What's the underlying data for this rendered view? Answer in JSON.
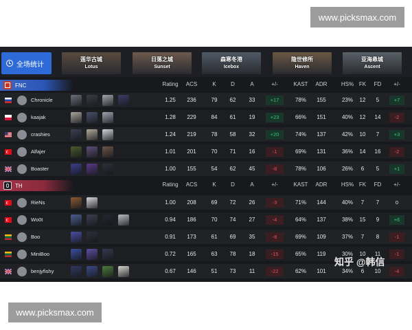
{
  "watermark_top": "www.picksmax.com",
  "watermark_bottom": "www.picksmax.com",
  "zhihu_watermark": "知乎 @韩信",
  "overall_button": "全场统计",
  "maps": [
    {
      "cn": "莲华古城",
      "en": "Lotus",
      "color": "#5a4b3e"
    },
    {
      "cn": "日落之城",
      "en": "Sunset",
      "color": "#6d5a4d"
    },
    {
      "cn": "森寒冬港",
      "en": "Icebox",
      "color": "#4f5a66"
    },
    {
      "cn": "隐世修所",
      "en": "Haven",
      "color": "#6b5845"
    },
    {
      "cn": "亚海悬城",
      "en": "Ascent",
      "color": "#596068"
    }
  ],
  "columns": [
    "Rating",
    "ACS",
    "K",
    "D",
    "A",
    "+/-",
    "KAST",
    "ADR",
    "HS%",
    "FK",
    "FD",
    "+/-"
  ],
  "teams": [
    {
      "name": "FNC",
      "players": [
        {
          "name": "Chronicle",
          "flag": "ru",
          "agents": [
            "#6b6f7a",
            "#3b3d47",
            "#a0a4ad",
            "#3d3b66"
          ],
          "rating": "1.25",
          "acs": "236",
          "k": "79",
          "d": "62",
          "a": "33",
          "diff": "+17",
          "kast": "78%",
          "adr": "155",
          "hs": "23%",
          "fk": "12",
          "fd": "5",
          "fdiff": "+7"
        },
        {
          "name": "kaajak",
          "flag": "pl",
          "agents": [
            "#a8a39a",
            "#4a4f6a",
            "#9fa4b0"
          ],
          "rating": "1.28",
          "acs": "229",
          "k": "84",
          "d": "61",
          "a": "19",
          "diff": "+23",
          "kast": "66%",
          "adr": "151",
          "hs": "40%",
          "fk": "12",
          "fd": "14",
          "fdiff": "-2"
        },
        {
          "name": "crashies",
          "flag": "us",
          "agents": [
            "#3c3f52",
            "#b1a897",
            "#cfd3da"
          ],
          "rating": "1.24",
          "acs": "219",
          "k": "78",
          "d": "58",
          "a": "32",
          "diff": "+20",
          "kast": "74%",
          "adr": "137",
          "hs": "42%",
          "fk": "10",
          "fd": "7",
          "fdiff": "+3"
        },
        {
          "name": "Alfajer",
          "flag": "tr",
          "agents": [
            "#4a5b2d",
            "#5f4e77",
            "#6a5648"
          ],
          "rating": "1.01",
          "acs": "201",
          "k": "70",
          "d": "71",
          "a": "16",
          "diff": "-1",
          "kast": "69%",
          "adr": "131",
          "hs": "36%",
          "fk": "14",
          "fd": "16",
          "fdiff": "-2"
        },
        {
          "name": "Boaster",
          "flag": "gb",
          "agents": [
            "#3b3e8c",
            "#5b3a86",
            "#2d2f3a"
          ],
          "rating": "1.00",
          "acs": "155",
          "k": "54",
          "d": "62",
          "a": "45",
          "diff": "-8",
          "kast": "78%",
          "adr": "106",
          "hs": "26%",
          "fk": "6",
          "fd": "5",
          "fdiff": "+1"
        }
      ]
    },
    {
      "name": "TH",
      "players": [
        {
          "name": "RieNs",
          "flag": "tr",
          "agents": [
            "#8a5b34",
            "#d8d8dc"
          ],
          "rating": "1.00",
          "acs": "208",
          "k": "69",
          "d": "72",
          "a": "26",
          "diff": "-3",
          "kast": "71%",
          "adr": "144",
          "hs": "40%",
          "fk": "7",
          "fd": "7",
          "fdiff": "0"
        },
        {
          "name": "Wo0t",
          "flag": "tr",
          "agents": [
            "#4a5e8c",
            "#3c3f52",
            "#242630",
            "#b9bcc4"
          ],
          "rating": "0.94",
          "acs": "186",
          "k": "70",
          "d": "74",
          "a": "27",
          "diff": "-4",
          "kast": "64%",
          "adr": "137",
          "hs": "38%",
          "fk": "15",
          "fd": "9",
          "fdiff": "+6"
        },
        {
          "name": "Boo",
          "flag": "lt",
          "agents": [
            "#4a4fa0",
            "#2e2f3a"
          ],
          "rating": "0.91",
          "acs": "173",
          "k": "61",
          "d": "69",
          "a": "35",
          "diff": "-8",
          "kast": "69%",
          "adr": "109",
          "hs": "37%",
          "fk": "7",
          "fd": "8",
          "fdiff": "-1"
        },
        {
          "name": "MiniBoo",
          "flag": "lt",
          "agents": [
            "#3a4f9c",
            "#5e4da0",
            "#343a4f"
          ],
          "rating": "0.72",
          "acs": "165",
          "k": "63",
          "d": "78",
          "a": "18",
          "diff": "-15",
          "kast": "65%",
          "adr": "119",
          "hs": "30%",
          "fk": "10",
          "fd": "11",
          "fdiff": "-1"
        },
        {
          "name": "benjyfishy",
          "flag": "gb",
          "agents": [
            "#33385f",
            "#3d4a86",
            "#4d7a3a",
            "#d4d2cc"
          ],
          "rating": "0.67",
          "acs": "146",
          "k": "51",
          "d": "73",
          "a": "11",
          "diff": "-22",
          "kast": "62%",
          "adr": "101",
          "hs": "34%",
          "fk": "6",
          "fd": "10",
          "fdiff": "-4"
        }
      ]
    }
  ]
}
